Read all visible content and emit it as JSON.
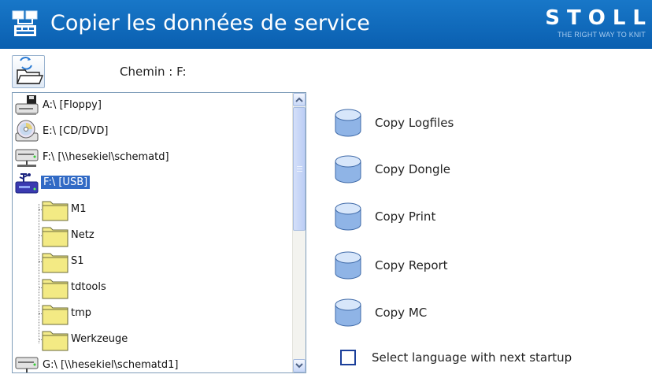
{
  "header": {
    "title": "Copier les données de service",
    "brand_name": "STOLL",
    "brand_tagline": "THE RIGHT WAY TO KNIT"
  },
  "path": {
    "label": "Chemin :  F:"
  },
  "tree": {
    "drives": [
      {
        "label": "A:\\  [Floppy]",
        "icon": "floppy-drive-icon"
      },
      {
        "label": "E:\\  [CD/DVD]",
        "icon": "cd-dvd-drive-icon"
      },
      {
        "label": "F:\\  [\\\\hesekiel\\schematd]",
        "icon": "network-drive-icon"
      },
      {
        "label": "F:\\  [USB]",
        "icon": "usb-drive-icon",
        "selected": true
      },
      {
        "label": "G:\\  [\\\\hesekiel\\schematd1]",
        "icon": "network-drive-icon"
      }
    ],
    "folders": [
      "M1",
      "Netz",
      "S1",
      "tdtools",
      "tmp",
      "Werkzeuge"
    ]
  },
  "actions": {
    "copy_logfiles": "Copy Logfiles",
    "copy_dongle": "Copy Dongle",
    "copy_print": "Copy Print",
    "copy_report": "Copy Report",
    "copy_mc": "Copy MC"
  },
  "options": {
    "select_language_label": "Select language with next startup",
    "select_language_checked": false
  },
  "colors": {
    "header_blue": "#0f6ac0",
    "selection_blue": "#316ac5",
    "folder_yellow": "#f4ec8a"
  }
}
